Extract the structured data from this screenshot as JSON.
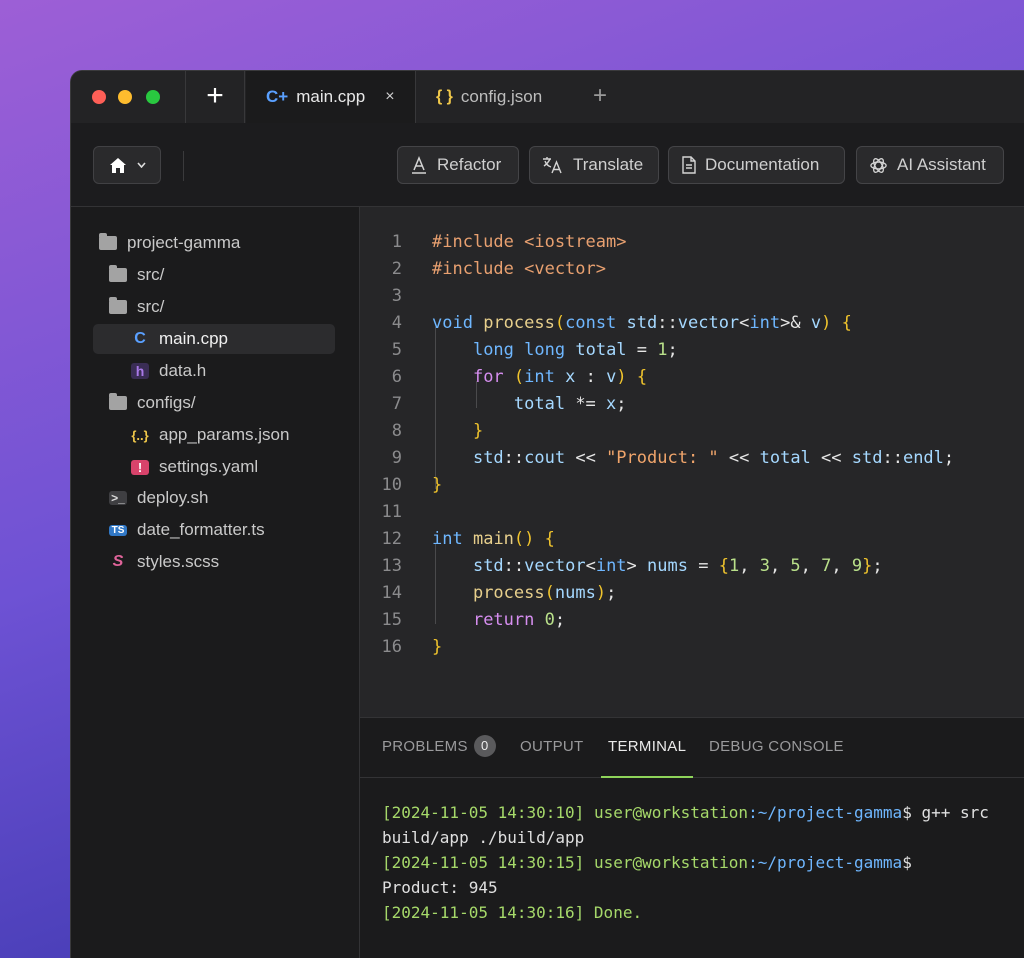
{
  "titlebar": {
    "new_tab_label": "+",
    "tabs": [
      {
        "icon": "cpp-icon",
        "icon_glyph": "C+",
        "label": "main.cpp",
        "close": "×"
      },
      {
        "icon": "json-icon",
        "icon_glyph": "{ }",
        "label": "config.json"
      }
    ],
    "add_tab": "+"
  },
  "toolbar": {
    "home_icon": "home-icon",
    "buttons": [
      {
        "icon": "text-format-icon",
        "label": "Refactor"
      },
      {
        "icon": "translate-icon",
        "label": "Translate"
      },
      {
        "icon": "document-icon",
        "label": "Documentation"
      },
      {
        "icon": "openai-icon",
        "label": "AI Assistant"
      }
    ]
  },
  "sidebar": {
    "items": [
      {
        "label": "project-gamma",
        "type": "folder"
      },
      {
        "label": "src/",
        "type": "folder"
      },
      {
        "label": "src/",
        "type": "folder"
      },
      {
        "label": "main.cpp",
        "type": "cpp",
        "selected": true
      },
      {
        "label": "data.h",
        "type": "header"
      },
      {
        "label": "configs/",
        "type": "folder"
      },
      {
        "label": "app_params.json",
        "type": "json"
      },
      {
        "label": "settings.yaml",
        "type": "yaml"
      },
      {
        "label": "deploy.sh",
        "type": "shell"
      },
      {
        "label": "date_formatter.ts",
        "type": "typescript"
      },
      {
        "label": "styles.scss",
        "type": "scss"
      }
    ]
  },
  "editor": {
    "line_numbers": [
      "1",
      "2",
      "3",
      "4",
      "5",
      "6",
      "7",
      "8",
      "9",
      "10",
      "11",
      "12",
      "13",
      "14",
      "15",
      "16"
    ],
    "lines": [
      "#include <iostream>",
      "#include <vector>",
      "",
      "void process(const std::vector<int>& v) {",
      "    long long total = 1;",
      "    for (int x : v) {",
      "        total *= x;",
      "    }",
      "    std::cout << \"Product: \" << total << std::endl;",
      "}",
      "",
      "int main() {",
      "    std::vector<int> nums = {1, 3, 5, 7, 9};",
      "    process(nums);",
      "    return 0;",
      "}"
    ]
  },
  "panel": {
    "tabs": [
      "PROBLEMS",
      "OUTPUT",
      "TERMINAL",
      "DEBUG CONSOLE"
    ],
    "problems_count": "0",
    "active_tab": "TERMINAL",
    "terminal": {
      "l1_ts": "[2024-11-05 14:30:10]",
      "l1_user": "user@workstation",
      "l1_path": ":~/project-gamma",
      "l1_cmd": "$ g++ src",
      "l2": "build/app ./build/app",
      "l3_ts": "[2024-11-05 14:30:15]",
      "l3_user": "user@workstation",
      "l3_path": ":~/project-gamma",
      "l3_cmd": "$",
      "l4": "Product: 945",
      "l5": "[2024-11-05 14:30:16] Done."
    }
  },
  "colors": {
    "background_gradient_start": "#9d5fd6",
    "window_bg": "#1b1b1c",
    "editor_bg": "#262628",
    "active_tab_underline": "#8fd45a",
    "accent_blue": "#6fb7ff"
  }
}
